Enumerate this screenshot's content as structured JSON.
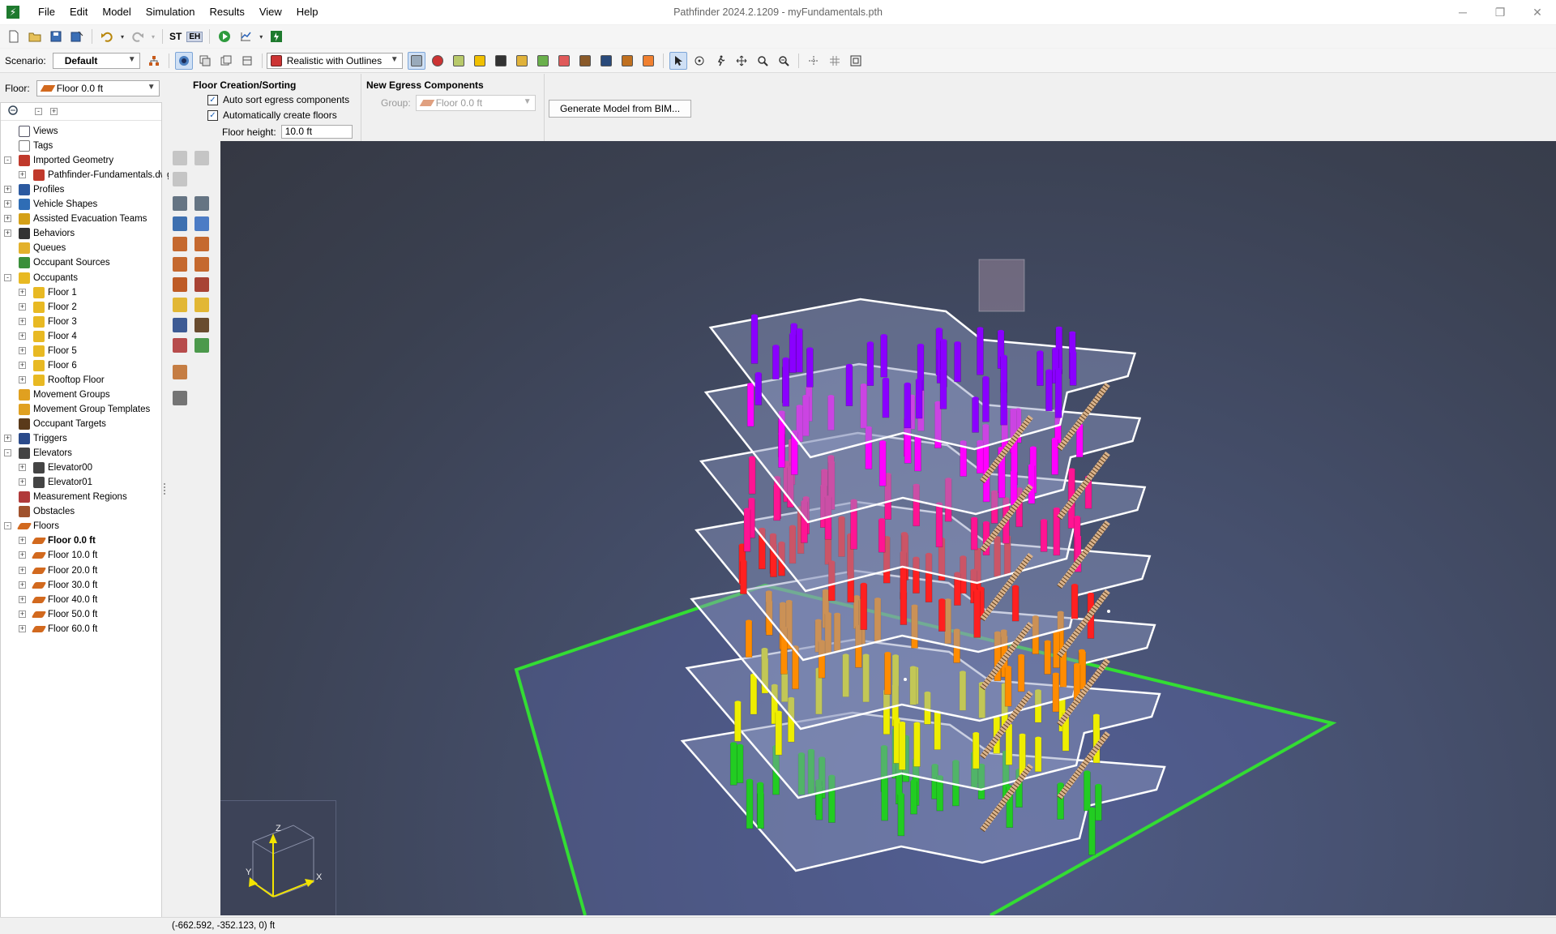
{
  "app": {
    "window_title": "Pathfinder 2024.2.1209 - myFundamentals.pth",
    "menu": [
      "File",
      "Edit",
      "Model",
      "Simulation",
      "Results",
      "View",
      "Help"
    ]
  },
  "toolbar": {
    "st_label": "ST",
    "eh_label": "EH",
    "scenario_label": "Scenario:",
    "scenario_value": "Default",
    "render_mode": "Realistic with Outlines"
  },
  "floor_selector": {
    "label": "Floor:",
    "value": "Floor 0.0 ft"
  },
  "properties": {
    "floor_creation": {
      "title": "Floor Creation/Sorting",
      "auto_sort_label": "Auto sort egress components",
      "auto_sort_checked": true,
      "auto_create_label": "Automatically create floors",
      "auto_create_checked": true,
      "floor_height_label": "Floor height:",
      "floor_height_value": "10.0 ft"
    },
    "new_egress": {
      "title": "New Egress Components",
      "group_label": "Group:",
      "group_value": "Floor 0.0 ft"
    },
    "generate_bim_label": "Generate Model from BIM..."
  },
  "tree": {
    "items": [
      {
        "label": "Views",
        "level": 0,
        "expander": "",
        "icon": "views-icon"
      },
      {
        "label": "Tags",
        "level": 0,
        "expander": "",
        "icon": "tag-icon"
      },
      {
        "label": "Imported Geometry",
        "level": 0,
        "expander": "-",
        "icon": "geometry-icon"
      },
      {
        "label": "Pathfinder-Fundamentals.dwg",
        "level": 1,
        "expander": "+",
        "icon": "geometry-icon"
      },
      {
        "label": "Profiles",
        "level": 0,
        "expander": "+",
        "icon": "profile-icon"
      },
      {
        "label": "Vehicle Shapes",
        "level": 0,
        "expander": "+",
        "icon": "vehicle-icon"
      },
      {
        "label": "Assisted Evacuation Teams",
        "level": 0,
        "expander": "+",
        "icon": "team-icon"
      },
      {
        "label": "Behaviors",
        "level": 0,
        "expander": "+",
        "icon": "behavior-icon"
      },
      {
        "label": "Queues",
        "level": 0,
        "expander": "",
        "icon": "queue-icon"
      },
      {
        "label": "Occupant Sources",
        "level": 0,
        "expander": "",
        "icon": "source-icon"
      },
      {
        "label": "Occupants",
        "level": 0,
        "expander": "-",
        "icon": "occupants-icon"
      },
      {
        "label": "Floor 1",
        "level": 1,
        "expander": "+",
        "icon": "occupants-icon"
      },
      {
        "label": "Floor 2",
        "level": 1,
        "expander": "+",
        "icon": "occupants-icon"
      },
      {
        "label": "Floor 3",
        "level": 1,
        "expander": "+",
        "icon": "occupants-icon"
      },
      {
        "label": "Floor 4",
        "level": 1,
        "expander": "+",
        "icon": "occupants-icon"
      },
      {
        "label": "Floor 5",
        "level": 1,
        "expander": "+",
        "icon": "occupants-icon"
      },
      {
        "label": "Floor 6",
        "level": 1,
        "expander": "+",
        "icon": "occupants-icon"
      },
      {
        "label": "Rooftop Floor",
        "level": 1,
        "expander": "+",
        "icon": "occupants-icon"
      },
      {
        "label": "Movement Groups",
        "level": 0,
        "expander": "",
        "icon": "group-icon"
      },
      {
        "label": "Movement Group Templates",
        "level": 0,
        "expander": "",
        "icon": "group-icon"
      },
      {
        "label": "Occupant Targets",
        "level": 0,
        "expander": "",
        "icon": "target-icon"
      },
      {
        "label": "Triggers",
        "level": 0,
        "expander": "+",
        "icon": "trigger-icon"
      },
      {
        "label": "Elevators",
        "level": 0,
        "expander": "-",
        "icon": "elevator-icon"
      },
      {
        "label": "Elevator00",
        "level": 1,
        "expander": "+",
        "icon": "elevator-icon"
      },
      {
        "label": "Elevator01",
        "level": 1,
        "expander": "+",
        "icon": "elevator-icon"
      },
      {
        "label": "Measurement Regions",
        "level": 0,
        "expander": "",
        "icon": "region-icon"
      },
      {
        "label": "Obstacles",
        "level": 0,
        "expander": "",
        "icon": "obstacle-icon"
      },
      {
        "label": "Floors",
        "level": 0,
        "expander": "-",
        "icon": "floor-icon"
      },
      {
        "label": "Floor 0.0 ft",
        "level": 1,
        "expander": "+",
        "icon": "floor-icon",
        "bold": true
      },
      {
        "label": "Floor 10.0 ft",
        "level": 1,
        "expander": "+",
        "icon": "floor-icon"
      },
      {
        "label": "Floor 20.0 ft",
        "level": 1,
        "expander": "+",
        "icon": "floor-icon"
      },
      {
        "label": "Floor 30.0 ft",
        "level": 1,
        "expander": "+",
        "icon": "floor-icon"
      },
      {
        "label": "Floor 40.0 ft",
        "level": 1,
        "expander": "+",
        "icon": "floor-icon"
      },
      {
        "label": "Floor 50.0 ft",
        "level": 1,
        "expander": "+",
        "icon": "floor-icon"
      },
      {
        "label": "Floor 60.0 ft",
        "level": 1,
        "expander": "+",
        "icon": "floor-icon"
      }
    ]
  },
  "viewport": {
    "axis_labels": {
      "z": "Z",
      "y": "Y",
      "x": "X"
    },
    "floor_colors": [
      "#22cc22",
      "#eeee00",
      "#ff8c00",
      "#ff2020",
      "#ff1493",
      "#ff00ff",
      "#8a00ff"
    ],
    "ground_outline_color": "#33dd33"
  },
  "status": {
    "coords": "(-662.592, -352.123, 0) ft"
  }
}
